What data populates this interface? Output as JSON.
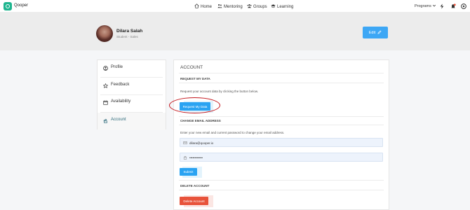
{
  "app": {
    "brand": "Qooper"
  },
  "nav": {
    "home": "Home",
    "mentoring": "Mentoring",
    "groups": "Groups",
    "learning": "Learning",
    "programs": "Programs"
  },
  "profile": {
    "name": "Dilara Salah",
    "role": "Student - Sales",
    "edit_label": "Edit"
  },
  "sidebar": {
    "items": [
      {
        "label": "Profile",
        "icon": "user-circle-icon"
      },
      {
        "label": "Feedback",
        "icon": "star-icon"
      },
      {
        "label": "Availability",
        "icon": "calendar-icon"
      },
      {
        "label": "Account",
        "icon": "account-icon"
      }
    ]
  },
  "account": {
    "title": "ACCOUNT",
    "request": {
      "heading": "REQUEST MY DATA",
      "help": "Request your account data by clicking the button below.",
      "button": "Request My Data"
    },
    "email": {
      "heading": "CHANGE EMAIL ADDRESS",
      "help": "Enter your new email and current password to change your email address.",
      "email_value": "dilara@qooper.io",
      "password_value": "••••••••••••",
      "submit": "Submit"
    },
    "delete": {
      "heading": "DELETE ACCOUNT",
      "button": "Delete Account"
    }
  },
  "colors": {
    "brand": "#1fb58f",
    "primary": "#2aa3f2",
    "danger": "#e8533b",
    "highlight": "#c4161c"
  }
}
